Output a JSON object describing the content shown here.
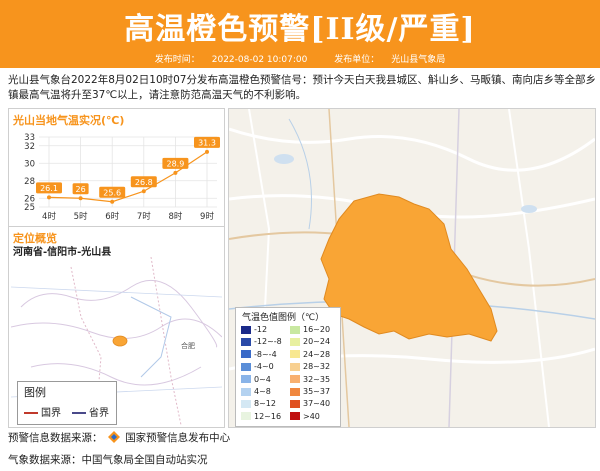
{
  "header": {
    "title": "高温橙色预警[II级/严重]",
    "publish_time_label": "发布时间：",
    "publish_time": "2022-08-02 10:07:00",
    "publisher_label": "发布单位：",
    "publisher": "光山县气象局"
  },
  "description": "光山县气象台2022年8月02日10时07分发布高温橙色预警信号：预计今天白天我县城区、斛山乡、马畈镇、南向店乡等全部乡镇最高气温将升至37℃以上，请注意防范高温天气的不利影响。",
  "temp_panel": {
    "title": "光山当地气温实况(℃)"
  },
  "chart_data": {
    "type": "line",
    "categories": [
      "4时",
      "5时",
      "6时",
      "7时",
      "8时",
      "9时"
    ],
    "values": [
      26.1,
      26,
      25.6,
      26.8,
      28.9,
      31.3
    ],
    "value_labels": [
      "26.1",
      "26",
      "25.6",
      "26.8",
      "28.9",
      "31.3"
    ],
    "ylim": [
      25,
      33
    ],
    "yticks": [
      25,
      26,
      28,
      30,
      32,
      33
    ],
    "grid": true,
    "line_color": "#f7941d"
  },
  "location_panel": {
    "title": "定位概览",
    "subtitle": "河南省-信阳市-光山县",
    "mini_cities": [
      "合肥"
    ],
    "legend_title": "图例",
    "legend_items": [
      {
        "label": "国界",
        "color": "#c0392b"
      },
      {
        "label": "省界",
        "color": "#4a4a8a"
      }
    ]
  },
  "map_legend": {
    "title": "气温色值图例（℃）",
    "left": [
      {
        "label": "-12",
        "color": "#1a2a8a"
      },
      {
        "label": "-12~-8",
        "color": "#2a4aa8"
      },
      {
        "label": "-8~-4",
        "color": "#3a6ac8"
      },
      {
        "label": "-4~0",
        "color": "#5a8ed8"
      },
      {
        "label": "0~4",
        "color": "#8ab4e8"
      },
      {
        "label": "4~8",
        "color": "#b4d2f0"
      },
      {
        "label": "8~12",
        "color": "#d4e8f4"
      },
      {
        "label": "12~16",
        "color": "#e8f4e0"
      }
    ],
    "right": [
      {
        "label": "16~20",
        "color": "#c8e8a0"
      },
      {
        "label": "20~24",
        "color": "#e8f0a0"
      },
      {
        "label": "24~28",
        "color": "#f8e890"
      },
      {
        "label": "28~32",
        "color": "#f8d090"
      },
      {
        "label": "32~35",
        "color": "#f8b070"
      },
      {
        "label": "35~37",
        "color": "#f08840"
      },
      {
        "label": "37~40",
        "color": "#e05020"
      },
      {
        "label": ">40",
        "color": "#c01010"
      }
    ]
  },
  "footer": {
    "warning_source_label": "预警信息数据来源：",
    "warning_source": "国家预警信息发布中心",
    "weather_source_label": "气象数据来源：",
    "weather_source": "中国气象局全国自动站实况"
  },
  "colors": {
    "accent": "#f7941d",
    "warning_area": "#f9a535"
  }
}
